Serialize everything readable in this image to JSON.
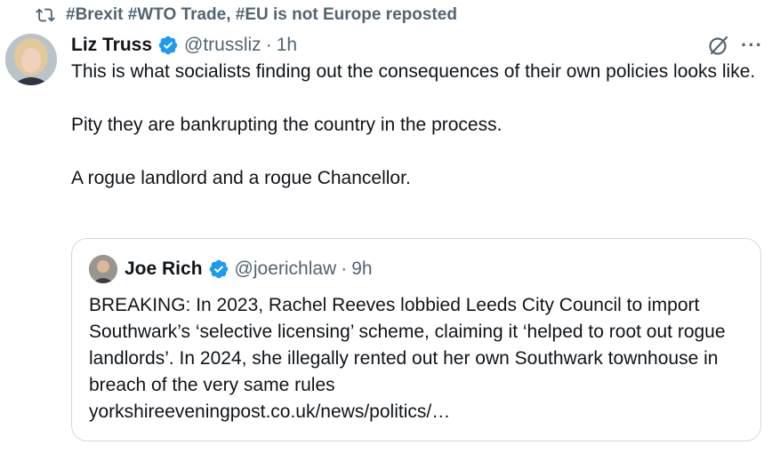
{
  "repost": {
    "icon": "repost-icon",
    "label": "#Brexit #WTO Trade, #EU is not Europe reposted"
  },
  "tweet": {
    "author_name": "Liz Truss",
    "handle": "@trussliz",
    "separator": "·",
    "time": "1h",
    "paragraphs": [
      "This is what socialists finding out the consequences of their own policies looks like.",
      "Pity they are bankrupting the country in the process.",
      "A rogue landlord and a rogue Chancellor."
    ],
    "more_label": "···"
  },
  "quote": {
    "author_name": "Joe Rich",
    "handle": "@joerichlaw",
    "separator": "·",
    "time": "9h",
    "text": "BREAKING: In 2023, Rachel Reeves lobbied Leeds City Council to import Southwark’s ‘selective licensing’ scheme, claiming it ‘helped to root out rogue landlords’. In 2024, she illegally rented out her own Southwark townhouse in breach of the very same rules",
    "link": "yorkshireeveningpost.co.uk/news/politics/…"
  },
  "colors": {
    "verified": "#1d9bf0",
    "secondary_text": "#536471",
    "border": "#cfd9de"
  }
}
